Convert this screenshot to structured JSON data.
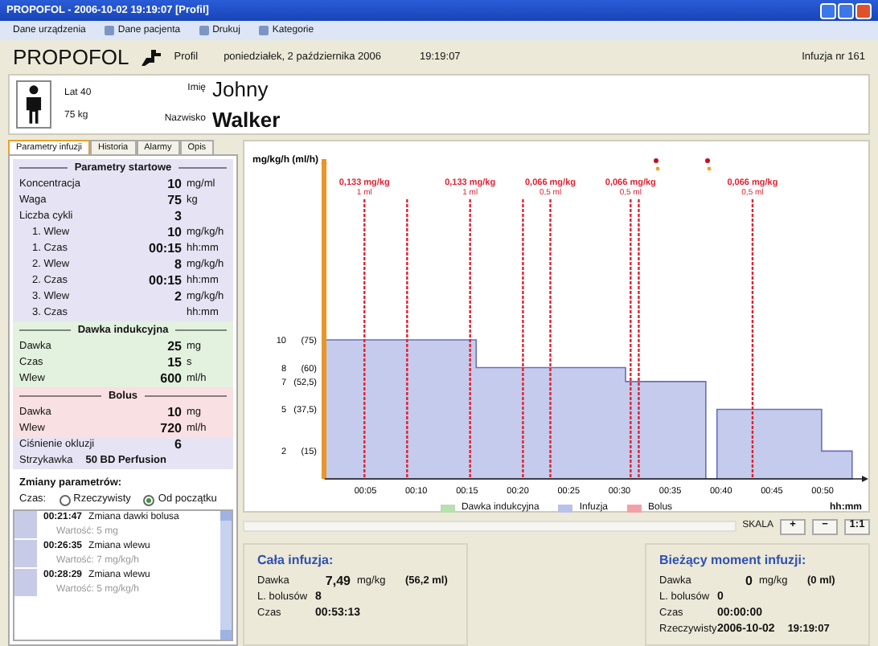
{
  "window": {
    "title": "PROPOFOL - 2006-10-02 19:19:07 [Profil]"
  },
  "menu": [
    {
      "label": "Dane urządzenia",
      "icon": false
    },
    {
      "label": "Dane pacjenta",
      "icon": true
    },
    {
      "label": "Drukuj",
      "icon": true
    },
    {
      "label": "Kategorie",
      "icon": true
    }
  ],
  "header": {
    "drug": "PROPOFOL",
    "mode": "Profil",
    "date": "poniedziałek, 2 października 2006",
    "time": "19:19:07",
    "infusion": "Infuzja nr 161"
  },
  "patient": {
    "age": "Lat 40",
    "weight": "75 kg",
    "first_name_label": "Imię",
    "first_name": "Johny",
    "last_name_label": "Nazwisko",
    "last_name": "Walker"
  },
  "tabs": [
    {
      "label": "Parametry infuzji",
      "selected": true
    },
    {
      "label": "Historia",
      "selected": false
    },
    {
      "label": "Alarmy",
      "selected": false
    },
    {
      "label": "Opis",
      "selected": false
    }
  ],
  "sections": [
    {
      "title": "Parametry startowe",
      "color": "#e6e4f4",
      "rows": [
        {
          "label": "Koncentracja",
          "value": "10",
          "unit": "mg/ml"
        },
        {
          "label": "Waga",
          "value": "75",
          "unit": "kg"
        },
        {
          "label": "Liczba cykli",
          "value": "3"
        },
        {
          "label": "1. Wlew",
          "value": "10",
          "unit": "mg/kg/h",
          "indent": true
        },
        {
          "label": "1. Czas",
          "value": "00:15",
          "unit": "hh:mm",
          "indent": true
        },
        {
          "label": "2. Wlew",
          "value": "8",
          "unit": "mg/kg/h",
          "indent": true
        },
        {
          "label": "2. Czas",
          "value": "00:15",
          "unit": "hh:mm",
          "indent": true
        },
        {
          "label": "3. Wlew",
          "value": "2",
          "unit": "mg/kg/h",
          "indent": true
        },
        {
          "label": "3. Czas",
          "unit": "hh:mm",
          "indent": true
        }
      ]
    },
    {
      "title": "Dawka indukcyjna",
      "color": "#e3f1df",
      "rows": [
        {
          "label": "Dawka",
          "value": "25",
          "unit": "mg"
        },
        {
          "label": "Czas",
          "value": "15",
          "unit": "s"
        },
        {
          "label": "Wlew",
          "value": "600",
          "unit": "ml/h"
        }
      ]
    },
    {
      "title": "Bolus",
      "color": "#f9e0e2",
      "rows": [
        {
          "label": "Dawka",
          "value": "10",
          "unit": "mg"
        },
        {
          "label": "Wlew",
          "value": "720",
          "unit": "ml/h"
        }
      ]
    },
    {
      "color": "#e6e4f4",
      "rows": [
        {
          "label": "Ciśnienie okluzji",
          "value": "6"
        },
        {
          "label": "Strzykawka",
          "value": "50 BD Perfusion",
          "inline": true
        }
      ]
    }
  ],
  "changes": {
    "title": "Zmiany parametrów:",
    "time_label": "Czas:",
    "options": [
      {
        "label": "Rzeczywisty",
        "selected": false
      },
      {
        "label": "Od początku",
        "selected": true
      }
    ],
    "items": [
      {
        "time": "00:21:47",
        "text": "Zmiana dawki bolusa",
        "value": "Wartość: 5 mg"
      },
      {
        "time": "00:26:35",
        "text": "Zmiana wlewu",
        "value": "Wartość: 7 mg/kg/h"
      },
      {
        "time": "00:28:29",
        "text": "Zmiana wlewu",
        "value": "Wartość: 5 mg/kg/h"
      }
    ]
  },
  "chart": {
    "chart_data": {
      "type": "area",
      "ylabel": "mg/kg/h (ml/h)",
      "xlabel": "hh:mm",
      "xlim": [
        1,
        54.5
      ],
      "ylim": [
        0,
        23
      ],
      "xticks": [
        {
          "value": 5,
          "label": "00:05"
        },
        {
          "value": 10,
          "label": "00:10"
        },
        {
          "value": 15,
          "label": "00:15"
        },
        {
          "value": 20,
          "label": "00:20"
        },
        {
          "value": 25,
          "label": "00:25"
        },
        {
          "value": 30,
          "label": "00:30"
        },
        {
          "value": 35,
          "label": "00:35"
        },
        {
          "value": 40,
          "label": "00:40"
        },
        {
          "value": 45,
          "label": "00:45"
        },
        {
          "value": 50,
          "label": "00:50"
        }
      ],
      "yticks": [
        10,
        8,
        7,
        5,
        2
      ],
      "x": [
        1,
        15.9,
        15.9,
        30.6,
        30.6,
        38.5,
        38.5,
        39.6,
        39.6,
        49.9,
        49.9,
        52.9,
        52.9
      ],
      "series": [
        {
          "color": "#c5cbec",
          "values": [
            10,
            10,
            8,
            8,
            7,
            7,
            0,
            0,
            5,
            5,
            2,
            2,
            0
          ]
        }
      ],
      "ref_lines": [
        {
          "axis": "x",
          "value": 4.9,
          "label": "0,133 mg/kg",
          "color": "#e02030"
        },
        {
          "axis": "x",
          "value": 9.1,
          "color": "#e02030"
        },
        {
          "axis": "x",
          "value": 15.3,
          "label": "0,133 mg/kg",
          "color": "#e02030"
        },
        {
          "axis": "x",
          "value": 20.5,
          "color": "#e02030"
        },
        {
          "axis": "x",
          "value": 23.2,
          "label": "0,066 mg/kg",
          "color": "#e02030"
        },
        {
          "axis": "x",
          "value": 31.1,
          "label": "0,066 mg/kg",
          "color": "#e02030"
        },
        {
          "axis": "x",
          "value": 31.9,
          "color": "#e02030"
        },
        {
          "axis": "x",
          "value": 43.1,
          "label": "0,066 mg/kg",
          "color": "#e02030"
        }
      ],
      "annotations": [
        "1 ml",
        "1 ml",
        "0,5 ml",
        "0,5 ml",
        "0,5 ml"
      ]
    },
    "alarm_markers": [
      {
        "kind": "alarm"
      },
      {
        "kind": "alarm"
      }
    ],
    "ytick_rates": [
      "(75)",
      "(60)",
      "(52,5)",
      "(37,5)",
      "(15)"
    ],
    "legend": [
      {
        "label": "Dawka indukcyjna",
        "color": "#b7dfb0"
      },
      {
        "label": "Infuzja",
        "color": "#b9c1ea"
      },
      {
        "label": "Bolus",
        "color": "#f4a0a8"
      }
    ]
  },
  "scale": {
    "label": "SKALA",
    "buttons": [
      "+",
      "−",
      "1:1"
    ]
  },
  "summary": {
    "title": "Cała infuzja:",
    "rows": [
      {
        "label": "Dawka",
        "value": "7,49",
        "unit": "mg/kg",
        "extra": "(56,2 ml)"
      },
      {
        "label": "L. bolusów",
        "value": "8"
      },
      {
        "label": "Czas",
        "value": "00:53:13"
      }
    ]
  },
  "current": {
    "title": "Bieżący moment infuzji:",
    "rows": [
      {
        "label": "Dawka",
        "value": "0",
        "unit": "mg/kg",
        "extra": "(0 ml)"
      },
      {
        "label": "L. bolusów",
        "value": "0"
      },
      {
        "label": "Czas",
        "value": "00:00:00"
      },
      {
        "label": "Rzeczywisty",
        "value": "2006-10-02",
        "extra": "19:19:07"
      }
    ]
  }
}
